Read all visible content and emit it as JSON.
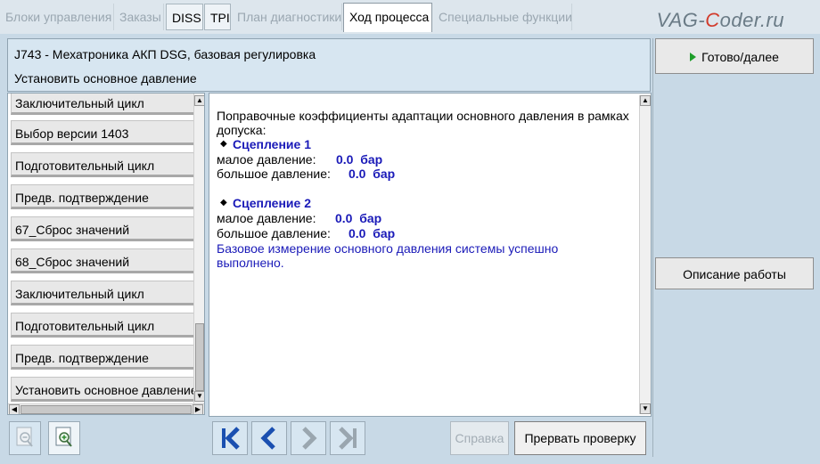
{
  "tabs": [
    {
      "label": "Блоки управления",
      "state": "disabled"
    },
    {
      "label": "Заказы",
      "state": "disabled"
    },
    {
      "label": "DISS",
      "state": "enabled"
    },
    {
      "label": "TPI",
      "state": "enabled"
    },
    {
      "label": "План диагностики",
      "state": "disabled"
    },
    {
      "label": "Ход процесса",
      "state": "active"
    },
    {
      "label": "Специальные функции",
      "state": "disabled"
    }
  ],
  "watermark": {
    "prefix": "VAG-",
    "accent": "C",
    "suffix": "oder.ru"
  },
  "header": {
    "module": "J743 - Мехатроника АКП DSG, базовая регулировка",
    "step": "Установить основное давление"
  },
  "steps": [
    "Заключительный цикл",
    "Выбор версии 1403",
    "Подготовительный цикл",
    "Предв. подтверждение",
    "67_Сброс значений",
    "68_Сброс значений",
    "Заключительный цикл",
    "Подготовительный цикл",
    "Предв. подтверждение",
    "Установить основное давление"
  ],
  "content": {
    "intro_line1": "Поправочные коэффициенты адаптации основного давления в рамках",
    "intro_line2": "допуска:",
    "clutch1": {
      "title": "Сцепление 1",
      "low_label": "малое давление:",
      "low_value": "0.0  бар",
      "high_label": "большое давление:",
      "high_value": "0.0  бар"
    },
    "clutch2": {
      "title": "Сцепление 2",
      "low_label": "малое давление:",
      "low_value": "0.0  бар",
      "high_label": "большое давление:",
      "high_value": "0.0  бар"
    },
    "result_line1": "Базовое измерение основного давления системы успешно",
    "result_line2": "выполнено."
  },
  "right": {
    "done_label": "Готово/далее",
    "describe_label": "Описание работы"
  },
  "bottom": {
    "help_label": "Справка",
    "abort_label": "Прервать проверку"
  },
  "colors": {
    "accent_blue": "#1a1ab8",
    "play_green": "#1e9e2a"
  }
}
